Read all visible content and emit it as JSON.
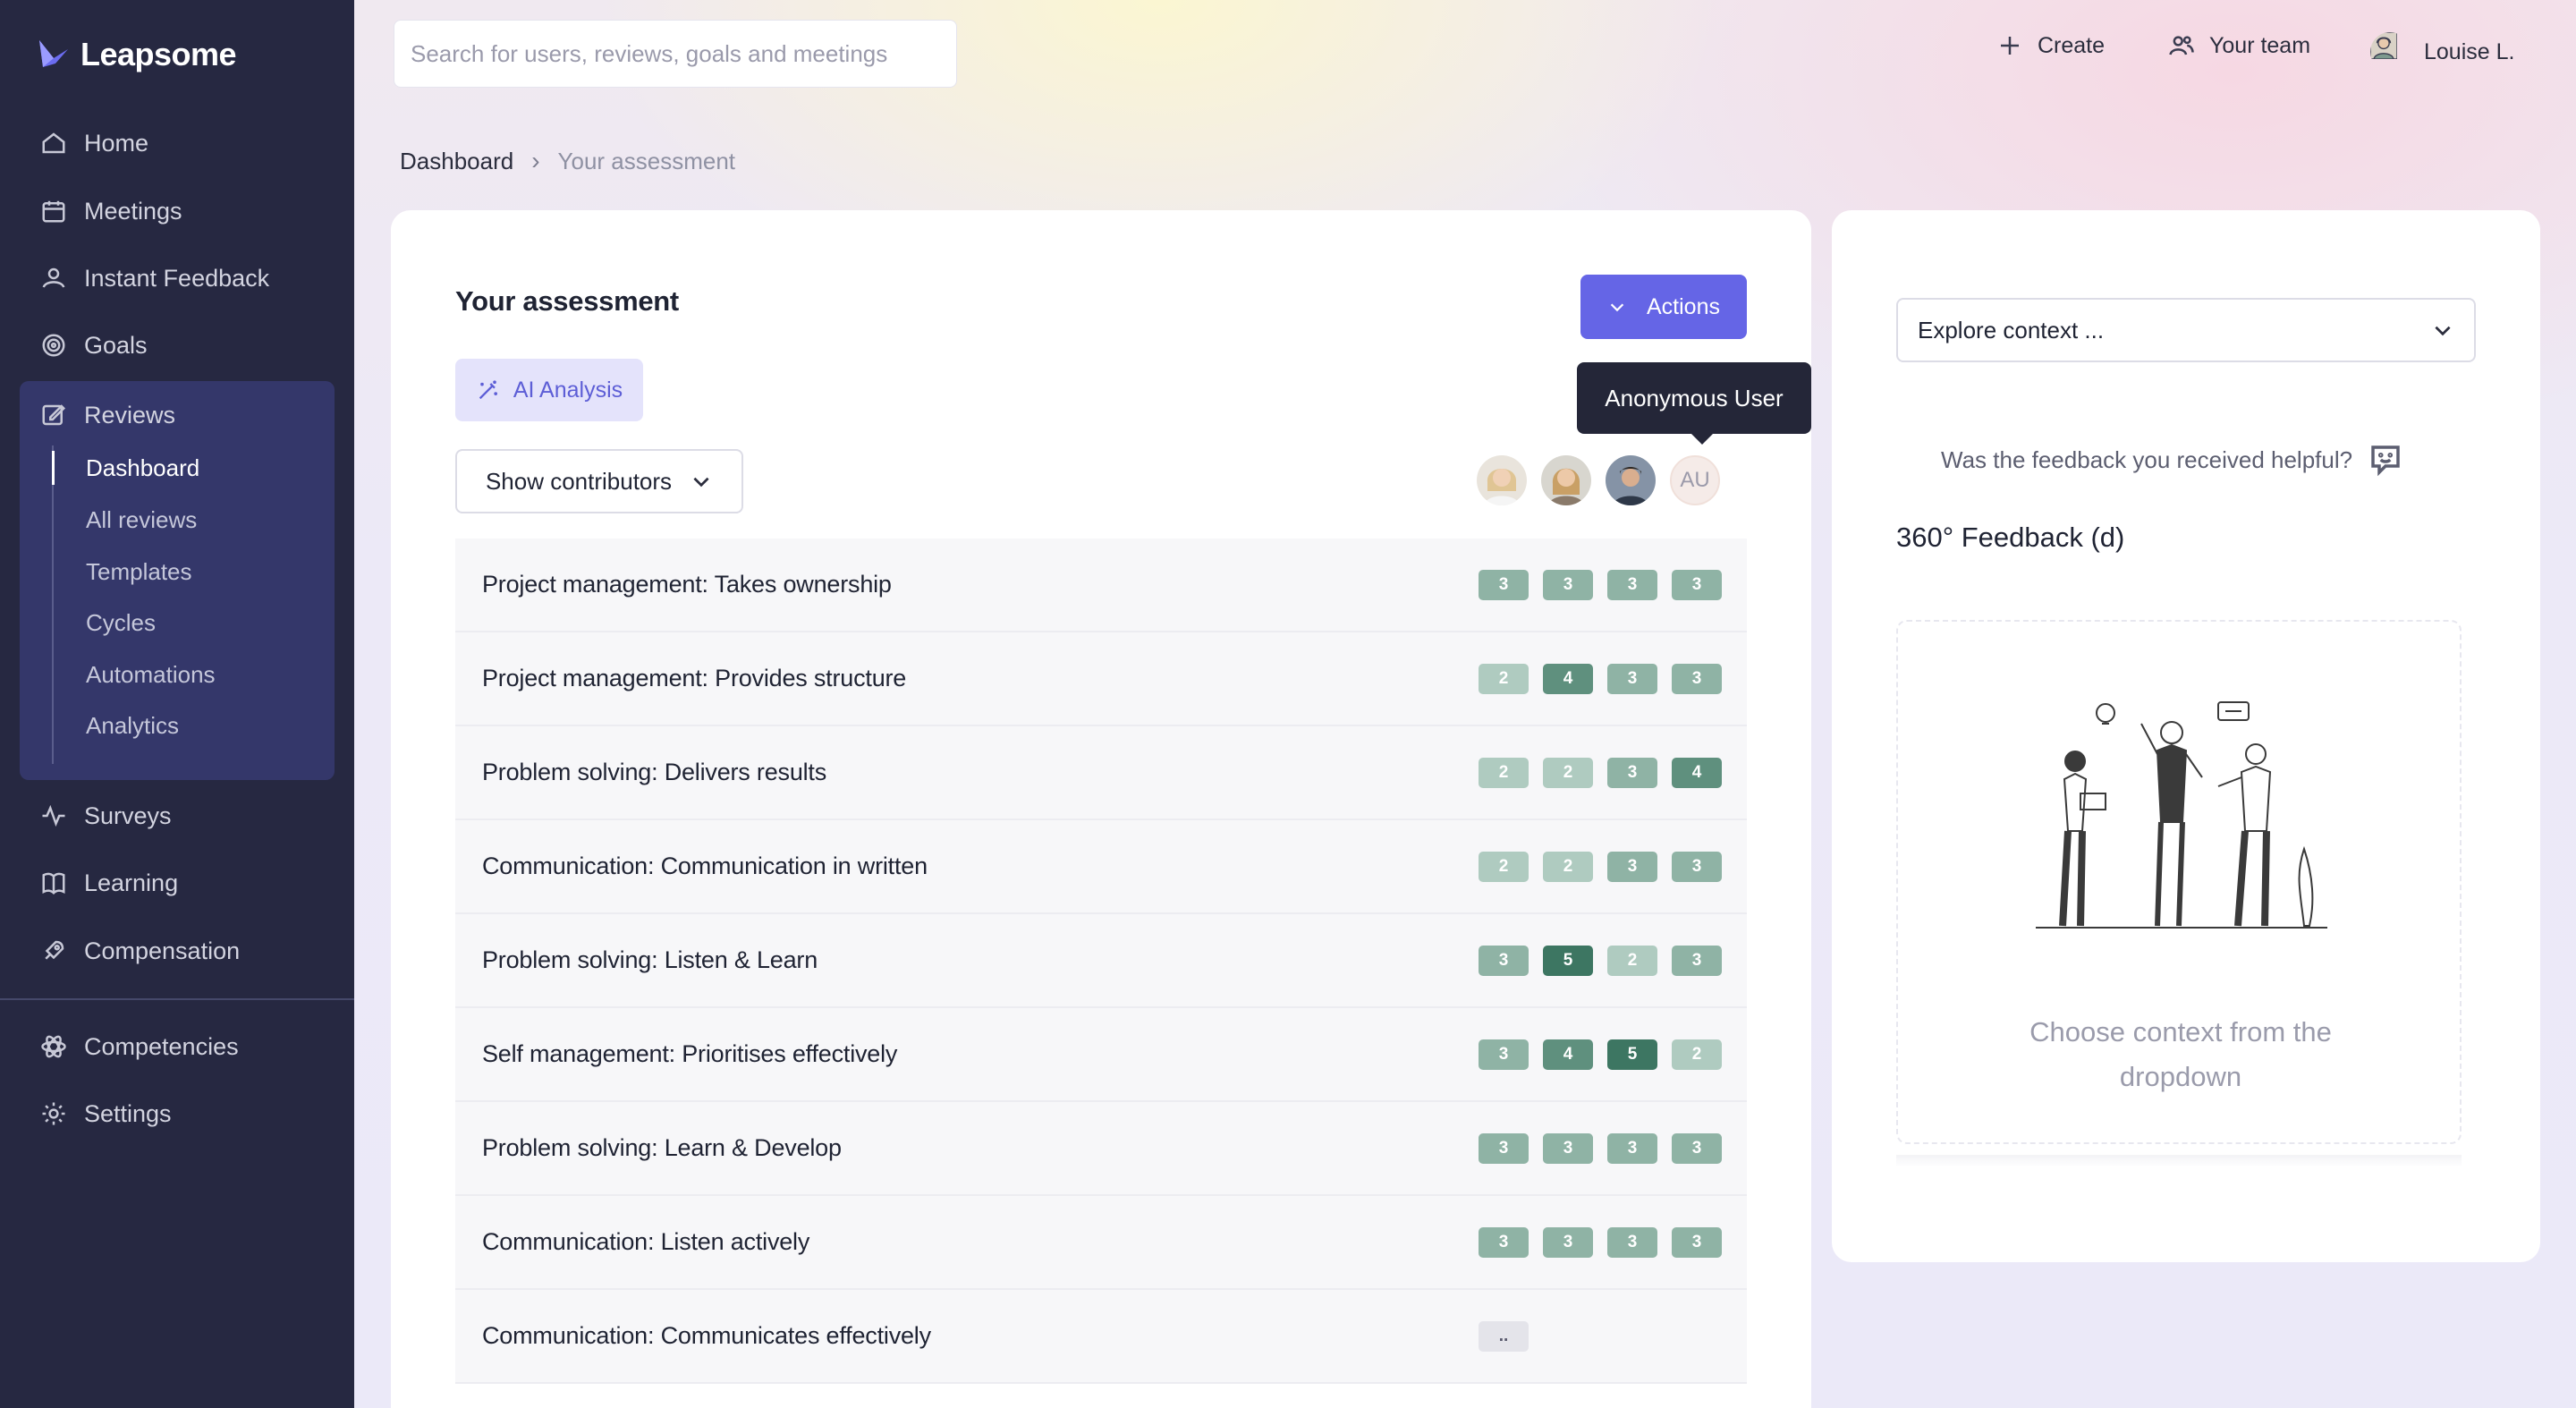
{
  "app": {
    "name": "Leapsome"
  },
  "search": {
    "placeholder": "Search for users, reviews, goals and meetings"
  },
  "topbar": {
    "create_label": "Create",
    "team_label": "Your team",
    "user_label": "Louise L."
  },
  "sidebar": {
    "items": [
      {
        "label": "Home",
        "icon": "home-icon"
      },
      {
        "label": "Meetings",
        "icon": "calendar-icon"
      },
      {
        "label": "Instant Feedback",
        "icon": "feedback-icon"
      },
      {
        "label": "Goals",
        "icon": "target-icon"
      },
      {
        "label": "Reviews",
        "icon": "edit-icon"
      },
      {
        "label": "Surveys",
        "icon": "pulse-icon"
      },
      {
        "label": "Learning",
        "icon": "book-icon"
      },
      {
        "label": "Compensation",
        "icon": "rocket-icon"
      },
      {
        "label": "Competencies",
        "icon": "atom-icon"
      },
      {
        "label": "Settings",
        "icon": "gear-icon"
      }
    ],
    "reviews_sub": [
      "Dashboard",
      "All reviews",
      "Templates",
      "Cycles",
      "Automations",
      "Analytics"
    ],
    "active_sub": "Dashboard"
  },
  "breadcrumb": {
    "parent": "Dashboard",
    "separator": "›",
    "current": "Your assessment"
  },
  "assessment": {
    "title": "Your assessment",
    "actions_label": "Actions",
    "ai_label": "AI Analysis",
    "contributors_label": "Show contributors",
    "tooltip": "Anonymous User",
    "anon_initials": "AU",
    "rows": [
      {
        "label": "Project management: Takes ownership",
        "scores": [
          "3",
          "3",
          "3",
          "3"
        ]
      },
      {
        "label": "Project management: Provides structure",
        "scores": [
          "2",
          "4",
          "3",
          "3"
        ]
      },
      {
        "label": "Problem solving: Delivers results",
        "scores": [
          "2",
          "2",
          "3",
          "4"
        ]
      },
      {
        "label": "Communication: Communication in written",
        "scores": [
          "2",
          "2",
          "3",
          "3"
        ]
      },
      {
        "label": "Problem solving: Listen & Learn",
        "scores": [
          "3",
          "5",
          "2",
          "3"
        ]
      },
      {
        "label": "Self management: Prioritises effectively",
        "scores": [
          "3",
          "4",
          "5",
          "2"
        ]
      },
      {
        "label": "Problem solving: Learn & Develop",
        "scores": [
          "3",
          "3",
          "3",
          "3"
        ]
      },
      {
        "label": "Communication: Listen actively",
        "scores": [
          "3",
          "3",
          "3",
          "3"
        ]
      },
      {
        "label": "Communication: Communicates effectively",
        "scores": [
          ".."
        ]
      }
    ]
  },
  "context": {
    "select_label": "Explore context ...",
    "helpful_question": "Was the feedback you received helpful?",
    "feedback_title": "360° Feedback (d)",
    "empty_message": "Choose context from the dropdown"
  },
  "colors": {
    "sidebar": "#262841",
    "accent": "#6565e6",
    "score_low": "#afcbc0",
    "score_mid": "#8fb3a5",
    "score_high": "#3d7662"
  }
}
